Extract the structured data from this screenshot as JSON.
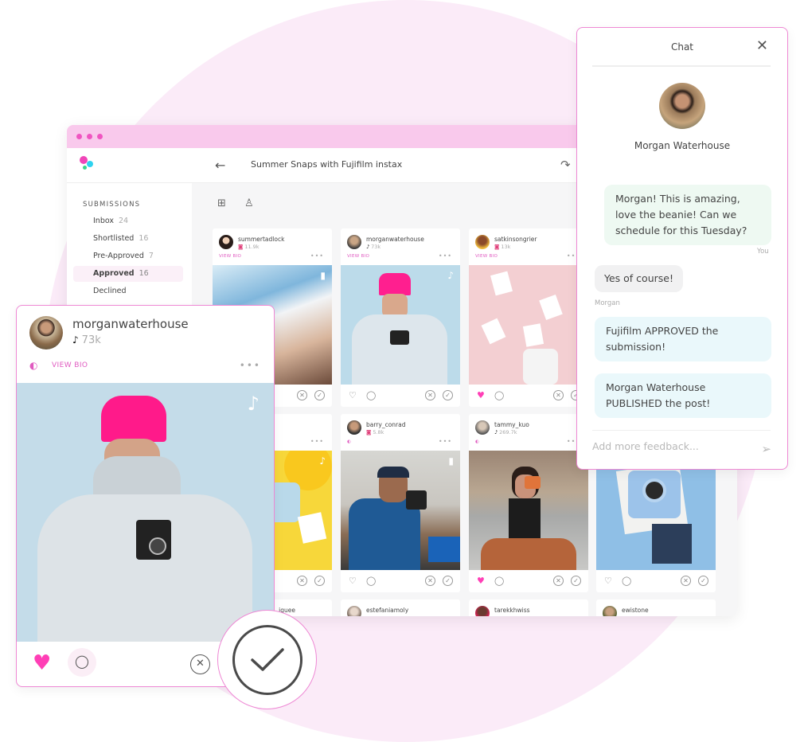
{
  "app": {
    "campaign_title": "Summer Snaps with Fujifilm instax",
    "colors": {
      "accent": "#f055c1",
      "titlebar": "#f9c9ec",
      "heart": "#ff3fb6",
      "border": "#ee88d4"
    }
  },
  "icons": {
    "back": "←",
    "share": "↷",
    "grid": "⊞",
    "person": "♙",
    "heart_outline": "♡",
    "heart_filled": "♥",
    "comment": "◯",
    "reject": "✕",
    "approve": "✓",
    "tiktok": "♪",
    "instagram": "◙",
    "video": "▮",
    "more": "•••",
    "bio": "◐",
    "close": "✕",
    "send": "➢"
  },
  "sidebar": {
    "heading": "SUBMISSIONS",
    "items": [
      {
        "label": "Inbox",
        "count": "24"
      },
      {
        "label": "Shortlisted",
        "count": "16"
      },
      {
        "label": "Pre-Approved",
        "count": "7"
      },
      {
        "label": "Approved",
        "count": "16",
        "active": true
      },
      {
        "label": "Declined",
        "count": ""
      }
    ]
  },
  "grid": {
    "view_bio": "VIEW BIO",
    "cards": [
      {
        "username": "summertadlock",
        "platform": "instagram",
        "followers": "11.9k",
        "liked": false
      },
      {
        "username": "morganwaterhouse",
        "platform": "tiktok",
        "followers": "73k",
        "liked": false
      },
      {
        "username": "satkinsongrier",
        "platform": "instagram",
        "followers": "13k",
        "liked": true
      },
      {
        "username": "",
        "platform": "tiktok",
        "followers": "",
        "liked": false
      },
      {
        "username": "barry_conrad",
        "platform": "instagram",
        "followers": "5.8k",
        "liked": false
      },
      {
        "username": "tammy_kuo",
        "platform": "tiktok",
        "followers": "269.7k",
        "liked": true
      },
      {
        "username": "",
        "platform": "",
        "followers": "",
        "liked": false
      },
      {
        "username": "...iguee",
        "platform": "",
        "followers": "",
        "liked": false
      },
      {
        "username": "estefaniamoly",
        "platform": "instagram",
        "followers": "",
        "liked": false
      },
      {
        "username": "tarekkhwiss",
        "platform": "tiktok",
        "followers": "",
        "liked": false
      },
      {
        "username": "ewistone",
        "platform": "tiktok",
        "followers": "",
        "liked": false
      }
    ]
  },
  "featured": {
    "username": "morganwaterhouse",
    "platform": "tiktok",
    "followers": "73k",
    "view_bio": "VIEW BIO",
    "liked": true
  },
  "chat": {
    "title": "Chat",
    "contact_name": "Morgan Waterhouse",
    "messages": [
      {
        "from": "mine",
        "text": "Morgan! This is amazing, love the beanie! Can we schedule for this Tuesday?",
        "author": "You"
      },
      {
        "from": "theirs",
        "text": "Yes of course!",
        "author": "Morgan"
      },
      {
        "from": "system",
        "text": "Fujifilm APPROVED the submission!"
      },
      {
        "from": "system",
        "text": "Morgan Waterhouse PUBLISHED the post!"
      }
    ],
    "input_placeholder": "Add more feedback..."
  }
}
